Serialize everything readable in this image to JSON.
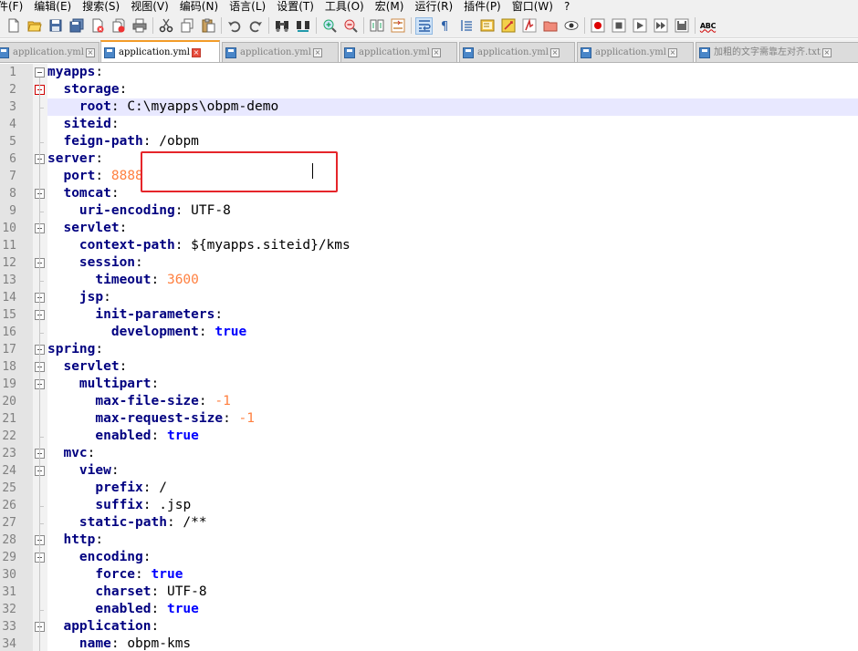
{
  "menubar": [
    "件(F)",
    "编辑(E)",
    "搜索(S)",
    "视图(V)",
    "编码(N)",
    "语言(L)",
    "设置(T)",
    "工具(O)",
    "宏(M)",
    "运行(R)",
    "插件(P)",
    "窗口(W)",
    "?"
  ],
  "toolbar": {
    "buttons": [
      "new-file-icon",
      "open-file-icon",
      "save-icon",
      "save-all-icon",
      "close-icon",
      "close-all-icon",
      "print-icon",
      "cut-icon",
      "copy-icon",
      "paste-icon",
      "undo-icon",
      "redo-icon",
      "find-icon",
      "replace-icon",
      "zoom-in-icon",
      "zoom-out-icon",
      "sync-vertical-icon",
      "sync-horizontal-icon",
      "word-wrap-icon",
      "show-all-chars-icon",
      "indent-guide-icon",
      "doc-map-icon",
      "function-list-icon",
      "lang-icon",
      "folder-workspace-icon",
      "monitor-icon",
      "record-macro-icon",
      "stop-record-icon",
      "play-macro-icon",
      "play-multiple-icon",
      "save-macro-icon",
      "spell-check-icon"
    ],
    "spell_label": "ABC"
  },
  "tabs": [
    {
      "label": "application.yml",
      "active": false
    },
    {
      "label": "application.yml",
      "active": true
    },
    {
      "label": "application.yml",
      "active": false
    },
    {
      "label": "application.yml",
      "active": false
    },
    {
      "label": "application.yml",
      "active": false
    },
    {
      "label": "application.yml",
      "active": false
    },
    {
      "label": "加粗的文字需靠左对齐.txt",
      "active": false
    }
  ],
  "editor": {
    "current_line": 3,
    "lines": [
      {
        "n": "1",
        "indent": "",
        "key": "myapps",
        "sep": ":",
        "value": "",
        "vtype": "v"
      },
      {
        "n": "2",
        "indent": "  ",
        "key": "storage",
        "sep": ":",
        "value": "",
        "vtype": "v"
      },
      {
        "n": "3",
        "indent": "    ",
        "key": "root",
        "sep": ": ",
        "value": "C:\\myapps\\obpm-demo",
        "vtype": "v"
      },
      {
        "n": "4",
        "indent": "  ",
        "key": "siteid",
        "sep": ":",
        "value": "",
        "vtype": "v"
      },
      {
        "n": "5",
        "indent": "  ",
        "key": "feign-path",
        "sep": ": ",
        "value": "/obpm",
        "vtype": "v"
      },
      {
        "n": "6",
        "indent": "",
        "key": "server",
        "sep": ":",
        "value": "",
        "vtype": "v"
      },
      {
        "n": "7",
        "indent": "  ",
        "key": "port",
        "sep": ": ",
        "value": "8888",
        "vtype": "num"
      },
      {
        "n": "8",
        "indent": "  ",
        "key": "tomcat",
        "sep": ":",
        "value": "",
        "vtype": "v"
      },
      {
        "n": "9",
        "indent": "    ",
        "key": "uri-encoding",
        "sep": ": ",
        "value": "UTF-8",
        "vtype": "v"
      },
      {
        "n": "10",
        "indent": "  ",
        "key": "servlet",
        "sep": ":",
        "value": "",
        "vtype": "v"
      },
      {
        "n": "11",
        "indent": "    ",
        "key": "context-path",
        "sep": ": ",
        "value": "${myapps.siteid}/kms",
        "vtype": "v"
      },
      {
        "n": "12",
        "indent": "    ",
        "key": "session",
        "sep": ":",
        "value": "",
        "vtype": "v"
      },
      {
        "n": "13",
        "indent": "      ",
        "key": "timeout",
        "sep": ": ",
        "value": "3600",
        "vtype": "num"
      },
      {
        "n": "14",
        "indent": "    ",
        "key": "jsp",
        "sep": ":",
        "value": "",
        "vtype": "v"
      },
      {
        "n": "15",
        "indent": "      ",
        "key": "init-parameters",
        "sep": ":",
        "value": "",
        "vtype": "v"
      },
      {
        "n": "16",
        "indent": "        ",
        "key": "development",
        "sep": ": ",
        "value": "true",
        "vtype": "bool"
      },
      {
        "n": "17",
        "indent": "",
        "key": "spring",
        "sep": ":",
        "value": "",
        "vtype": "v"
      },
      {
        "n": "18",
        "indent": "  ",
        "key": "servlet",
        "sep": ":",
        "value": "",
        "vtype": "v"
      },
      {
        "n": "19",
        "indent": "    ",
        "key": "multipart",
        "sep": ":",
        "value": "",
        "vtype": "v"
      },
      {
        "n": "20",
        "indent": "      ",
        "key": "max-file-size",
        "sep": ": ",
        "value": "-1",
        "vtype": "num"
      },
      {
        "n": "21",
        "indent": "      ",
        "key": "max-request-size",
        "sep": ": ",
        "value": "-1",
        "vtype": "num"
      },
      {
        "n": "22",
        "indent": "      ",
        "key": "enabled",
        "sep": ": ",
        "value": "true",
        "vtype": "bool"
      },
      {
        "n": "23",
        "indent": "  ",
        "key": "mvc",
        "sep": ":",
        "value": "",
        "vtype": "v"
      },
      {
        "n": "24",
        "indent": "    ",
        "key": "view",
        "sep": ":",
        "value": "",
        "vtype": "v"
      },
      {
        "n": "25",
        "indent": "      ",
        "key": "prefix",
        "sep": ": ",
        "value": "/",
        "vtype": "v"
      },
      {
        "n": "26",
        "indent": "      ",
        "key": "suffix",
        "sep": ": ",
        "value": ".jsp",
        "vtype": "v"
      },
      {
        "n": "27",
        "indent": "    ",
        "key": "static-path",
        "sep": ": ",
        "value": "/**",
        "vtype": "v"
      },
      {
        "n": "28",
        "indent": "  ",
        "key": "http",
        "sep": ":",
        "value": "",
        "vtype": "v"
      },
      {
        "n": "29",
        "indent": "    ",
        "key": "encoding",
        "sep": ":",
        "value": "",
        "vtype": "v"
      },
      {
        "n": "30",
        "indent": "      ",
        "key": "force",
        "sep": ": ",
        "value": "true",
        "vtype": "bool"
      },
      {
        "n": "31",
        "indent": "      ",
        "key": "charset",
        "sep": ": ",
        "value": "UTF-8",
        "vtype": "v"
      },
      {
        "n": "32",
        "indent": "      ",
        "key": "enabled",
        "sep": ": ",
        "value": "true",
        "vtype": "bool"
      },
      {
        "n": "33",
        "indent": "  ",
        "key": "application",
        "sep": ":",
        "value": "",
        "vtype": "v"
      },
      {
        "n": "34",
        "indent": "    ",
        "key": "name",
        "sep": ": ",
        "value": "obpm-kms",
        "vtype": "v"
      }
    ]
  },
  "colors": {
    "key": "#000080",
    "number": "#ff8040",
    "boolean": "#0000ff",
    "current_line": "#e8e8ff",
    "annotation_box": "#e5252a",
    "active_tab_accent": "#f39c28"
  }
}
